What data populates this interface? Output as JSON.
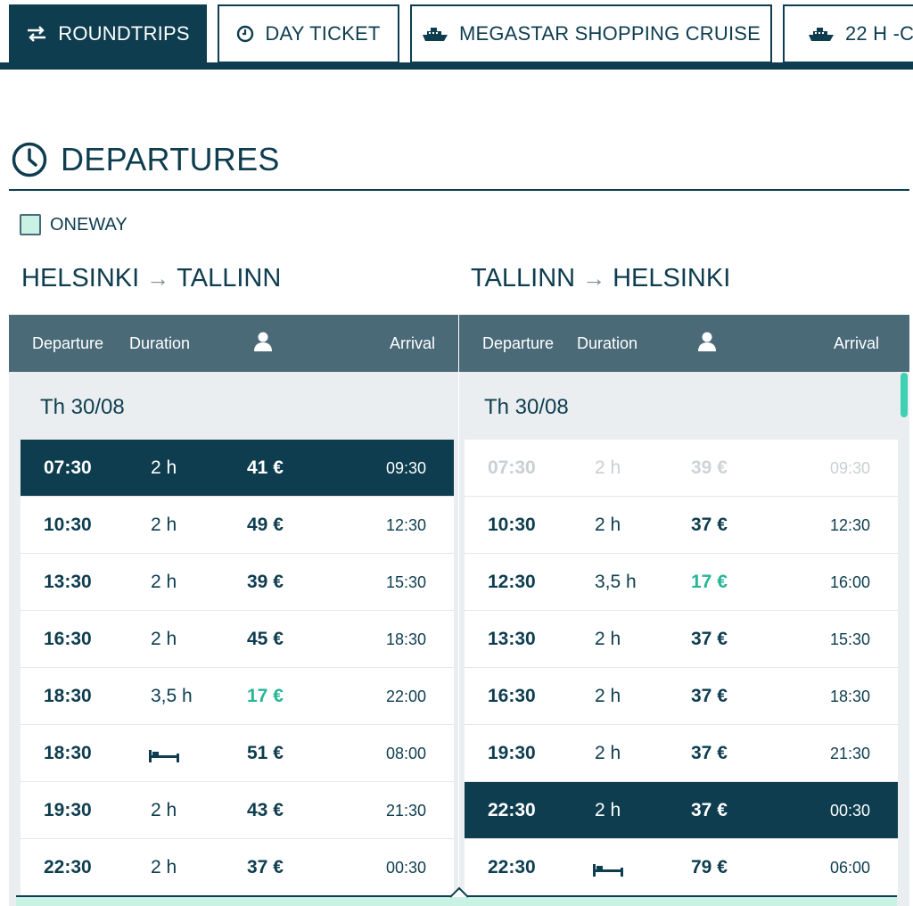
{
  "tabs": [
    {
      "label": "ROUNDTRIPS",
      "icon": "swap-arrows-icon",
      "active": true
    },
    {
      "label": "DAY TICKET",
      "icon": "clock-icon",
      "active": false
    },
    {
      "label": "MEGASTAR SHOPPING CRUISE",
      "icon": "ship-icon",
      "active": false
    },
    {
      "label": "22 H -C",
      "icon": "ship-icon",
      "active": false
    }
  ],
  "section": {
    "title": "DEPARTURES",
    "icon": "clock-icon"
  },
  "oneway": {
    "label": "ONEWAY",
    "checked": false
  },
  "columns": {
    "departure": "Departure",
    "duration": "Duration",
    "passenger_icon": "person-icon",
    "arrival": "Arrival"
  },
  "outbound": {
    "from": "HELSINKI",
    "to": "TALLINN",
    "date": "Th 30/08",
    "rows": [
      {
        "dep": "07:30",
        "dur": "2 h",
        "price": "41 €",
        "arr": "09:30",
        "selected": true
      },
      {
        "dep": "10:30",
        "dur": "2 h",
        "price": "49 €",
        "arr": "12:30"
      },
      {
        "dep": "13:30",
        "dur": "2 h",
        "price": "39 €",
        "arr": "15:30"
      },
      {
        "dep": "16:30",
        "dur": "2 h",
        "price": "45 €",
        "arr": "18:30"
      },
      {
        "dep": "18:30",
        "dur": "3,5 h",
        "price": "17 €",
        "arr": "22:00",
        "lowest": true
      },
      {
        "dep": "18:30",
        "dur": "",
        "sleep": true,
        "price": "51 €",
        "arr": "08:00"
      },
      {
        "dep": "19:30",
        "dur": "2 h",
        "price": "43 €",
        "arr": "21:30"
      },
      {
        "dep": "22:30",
        "dur": "2 h",
        "price": "37 €",
        "arr": "00:30"
      }
    ]
  },
  "return": {
    "from": "TALLINN",
    "to": "HELSINKI",
    "date": "Th 30/08",
    "rows": [
      {
        "dep": "07:30",
        "dur": "2 h",
        "price": "39 €",
        "arr": "09:30",
        "disabled": true
      },
      {
        "dep": "10:30",
        "dur": "2 h",
        "price": "37 €",
        "arr": "12:30"
      },
      {
        "dep": "12:30",
        "dur": "3,5 h",
        "price": "17 €",
        "arr": "16:00",
        "lowest": true
      },
      {
        "dep": "13:30",
        "dur": "2 h",
        "price": "37 €",
        "arr": "15:30"
      },
      {
        "dep": "16:30",
        "dur": "2 h",
        "price": "37 €",
        "arr": "18:30"
      },
      {
        "dep": "19:30",
        "dur": "2 h",
        "price": "37 €",
        "arr": "21:30"
      },
      {
        "dep": "22:30",
        "dur": "2 h",
        "price": "37 €",
        "arr": "00:30",
        "selected": true
      },
      {
        "dep": "22:30",
        "dur": "",
        "sleep": true,
        "price": "79 €",
        "arr": "06:00"
      }
    ]
  },
  "colors": {
    "primary": "#0d3d4f",
    "header": "#4a6a78",
    "accent": "#26b597",
    "mint": "#c9f1e4"
  }
}
